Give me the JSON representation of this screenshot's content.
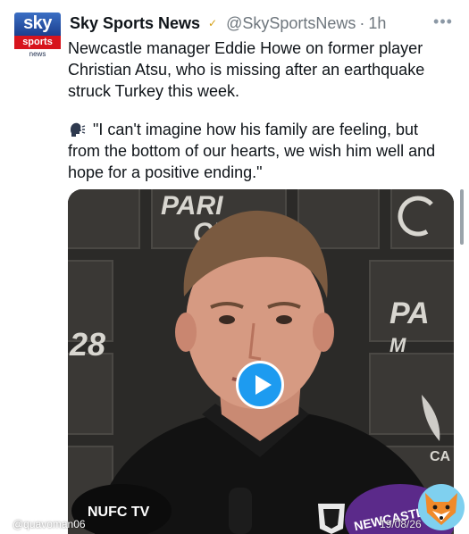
{
  "account": {
    "display_name": "Sky Sports News",
    "handle": "@SkySportsNews",
    "separator": "·",
    "time": "1h",
    "more_icon": "more-horizontal-icon",
    "avatar": {
      "top": "sky",
      "middle": "sports",
      "bottom": "news"
    }
  },
  "tweet": {
    "paragraph_1": "Newcastle manager Eddie Howe on former player Christian Atsu, who is missing after an earthquake struck Turkey this week.",
    "quote_icon": "speaking-head-icon",
    "paragraph_2": "\"I can't imagine how his family are feeling, but from the bottom of our hearts, we wish him well and hope for a positive ending.\""
  },
  "media": {
    "type": "video",
    "play_icon": "play-icon",
    "backdrop_text": [
      "PARI",
      "MATCH",
      "CH",
      "28"
    ],
    "sponsor_text": "NUFC TV",
    "mic_text": "NEWCASTLE"
  },
  "overlay": {
    "watermark": "@quavoman06",
    "date": "19/08/26",
    "logo_icon": "fox-logo-icon"
  },
  "colors": {
    "accent": "#1d9bf0",
    "text": "#0f1419",
    "secondary": "#6e767d",
    "sky_red": "#d7141d",
    "sky_blue": "#1c3f8f"
  }
}
